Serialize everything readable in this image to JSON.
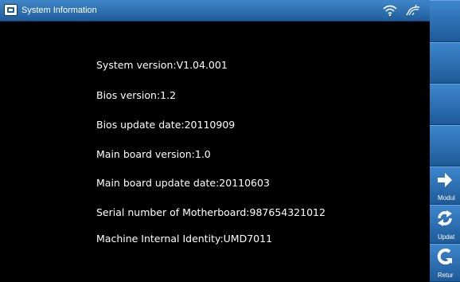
{
  "window": {
    "title": "System Information"
  },
  "status_icons": [
    "wifi-icon",
    "signal-icon"
  ],
  "info": {
    "lines": [
      "System version:V1.04.001",
      "Bios version:1.2",
      "Bios update date:20110909",
      "Main board version:1.0",
      "Main board update date:20110603",
      "Serial number of Motherboard:987654321012",
      "Machine Internal Identity:UMD7011"
    ]
  },
  "sidebar": {
    "buttons": [
      {
        "label": "Modul",
        "icon": "arrow-right-icon"
      },
      {
        "label": "Updat",
        "icon": "refresh-icon"
      },
      {
        "label": "Retur",
        "icon": "return-icon"
      }
    ]
  },
  "colors": {
    "titlebar": "#2a6fb0",
    "sidebar": "#2a6fb0",
    "background": "#000000",
    "text": "#ffffff"
  }
}
